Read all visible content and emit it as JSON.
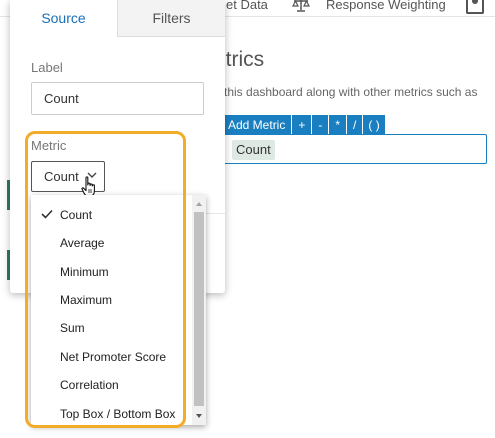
{
  "topbar": {
    "items": [
      "et Data",
      "Response Weighting"
    ],
    "icons": [
      "scale-icon",
      "user-profile-icon"
    ]
  },
  "background": {
    "heading": "etrics",
    "description": "n this dashboard along with other metrics such as",
    "toolbar": [
      "Add Metric",
      "+",
      "-",
      "*",
      "/",
      "( )"
    ],
    "formula_token": "Count"
  },
  "panel": {
    "tabs": [
      {
        "label": "Source",
        "active": true
      },
      {
        "label": "Filters",
        "active": false
      }
    ],
    "label_field": {
      "label": "Label",
      "value": "Count"
    },
    "metric_field": {
      "label": "Metric",
      "value": "Count"
    }
  },
  "dropdown": {
    "selected": "Count",
    "options": [
      "Count",
      "Average",
      "Minimum",
      "Maximum",
      "Sum",
      "Net Promoter Score",
      "Correlation",
      "Top Box / Bottom Box"
    ]
  },
  "colors": {
    "accent": "#1a7fc1",
    "highlight": "#f3ab2a",
    "token_bg": "#dfe9e3",
    "edge_mark": "#2e7d5b"
  }
}
